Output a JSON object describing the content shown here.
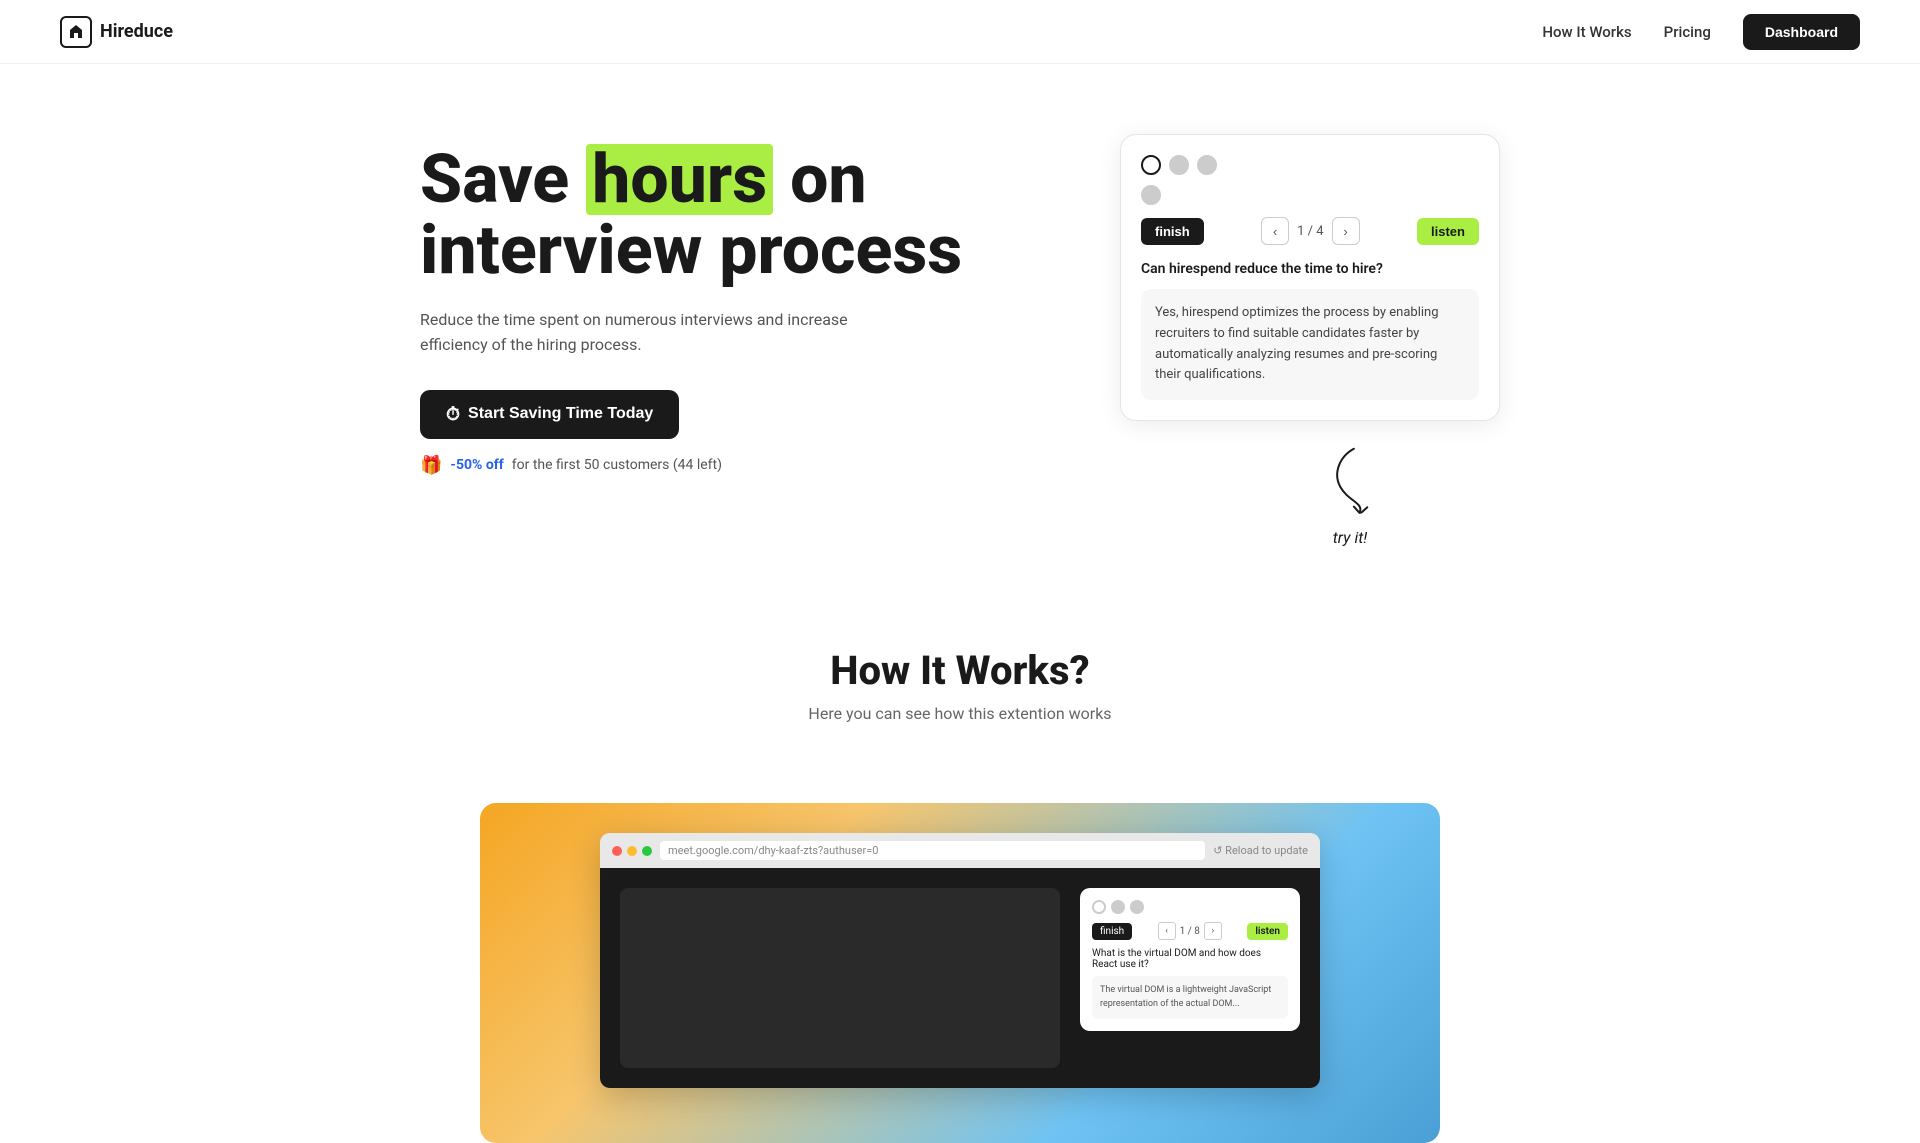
{
  "nav": {
    "logo_text": "Hireduce",
    "logo_icon": "🏠",
    "links": [
      {
        "label": "How It Works",
        "href": "#how-it-works"
      },
      {
        "label": "Pricing",
        "href": "#pricing"
      }
    ],
    "dashboard_label": "Dashboard"
  },
  "hero": {
    "heading_part1": "Save ",
    "heading_highlight": "hours",
    "heading_part2": " on interview process",
    "subtext": "Reduce the time spent on numerous interviews and increase efficiency of the hiring process.",
    "cta_label": "Start Saving Time Today",
    "cta_icon": "⏱",
    "promo_icon": "🎁",
    "promo_off": "-50% off",
    "promo_rest": "for the first 50 customers (44 left)"
  },
  "widget": {
    "finish_label": "finish",
    "counter": "1 / 4",
    "listen_label": "listen",
    "question": "Can hirespend reduce the time to hire?",
    "answer": "Yes, hirespend optimizes the process by enabling recruiters to find suitable candidates faster by automatically analyzing resumes and pre-scoring their qualifications.",
    "try_it": "try it!"
  },
  "how_it_works": {
    "title": "How It Works?",
    "subtitle": "Here you can see how this extention works"
  },
  "browser_mockup": {
    "url": "meet.google.com/dhy-kaaf-zts?authuser=0",
    "inner_counter": "1 / 8",
    "inner_btn": "finish",
    "inner_listen": "listen",
    "inner_question": "What is the virtual DOM and how does React use it?"
  }
}
